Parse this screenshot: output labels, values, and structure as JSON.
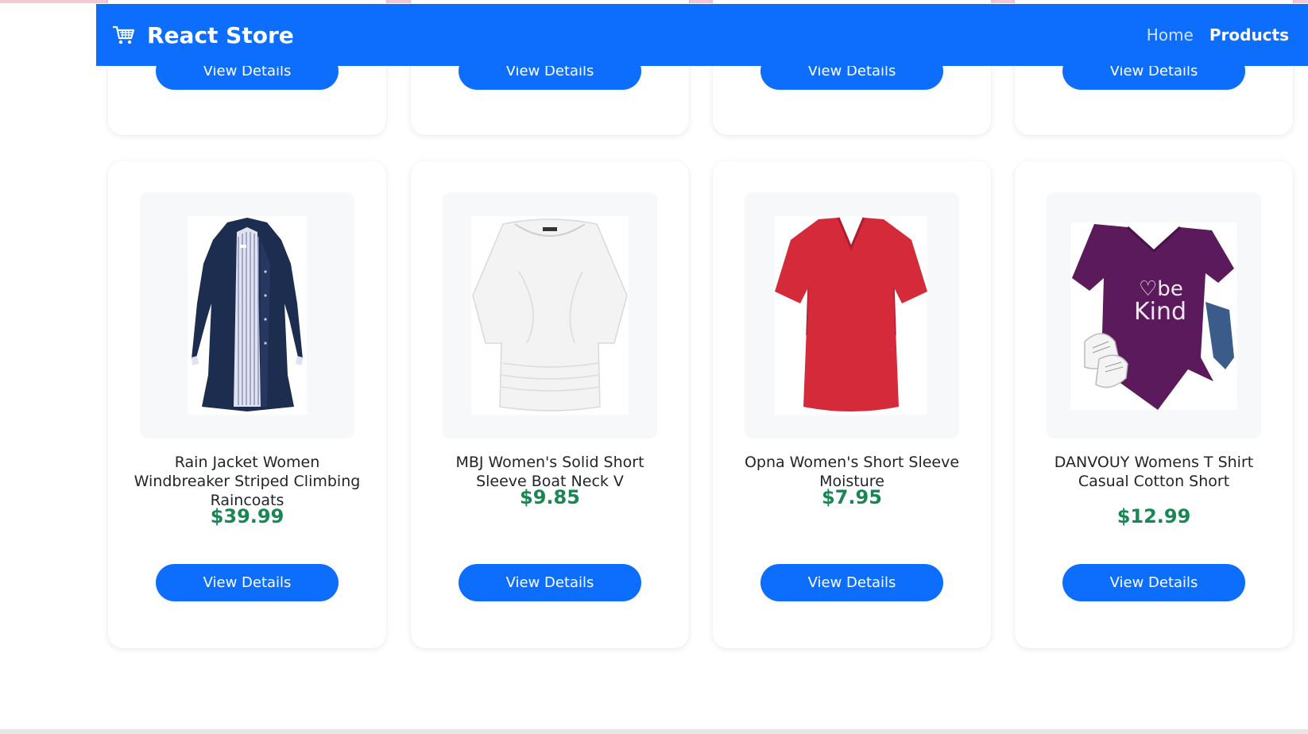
{
  "navbar": {
    "brand": "React Store",
    "brand_icon": "shopping-cart-icon",
    "links": [
      {
        "label": "Home",
        "active": false
      },
      {
        "label": "Products",
        "active": true
      }
    ],
    "background": "#0d6efd"
  },
  "top_row": {
    "buttons": [
      "View Details",
      "View Details",
      "View Details",
      "View Details"
    ]
  },
  "products": [
    {
      "title": "Rain Jacket Women Windbreaker Striped Climbing Raincoats",
      "price": "$39.99",
      "button": "View Details",
      "image": "navy-rain-jacket-image"
    },
    {
      "title": "MBJ Women's Solid Short Sleeve Boat Neck V",
      "price": "$9.85",
      "button": "View Details",
      "image": "white-top-image"
    },
    {
      "title": "Opna Women's Short Sleeve Moisture",
      "price": "$7.95",
      "button": "View Details",
      "image": "red-tshirt-image"
    },
    {
      "title": "DANVOUY Womens T Shirt Casual Cotton Short",
      "price": "$12.99",
      "button": "View Details",
      "image": "purple-be-kind-tshirt-image"
    }
  ],
  "colors": {
    "accent": "#0d6efd",
    "price": "#198754"
  },
  "shirt_text": "be Kind"
}
